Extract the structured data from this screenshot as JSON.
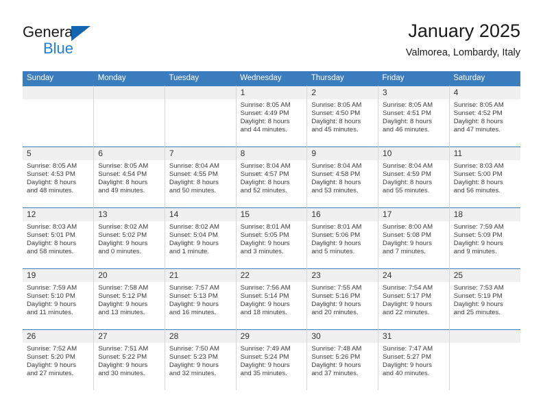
{
  "brand": {
    "name_dark": "General",
    "name_blue": "Blue",
    "accent_color": "#1f7fd4",
    "triangle_color": "#1265b0"
  },
  "header": {
    "title": "January 2025",
    "subtitle": "Valmorea, Lombardy, Italy"
  },
  "theme": {
    "header_row_bg": "#3a7cbe",
    "daynum_bg": "#f0f0f0",
    "cell_border": "#d4d4d4",
    "text": "#3a3a3a"
  },
  "weekday_headers": [
    "Sunday",
    "Monday",
    "Tuesday",
    "Wednesday",
    "Thursday",
    "Friday",
    "Saturday"
  ],
  "weeks": [
    [
      {
        "day": "",
        "lines": []
      },
      {
        "day": "",
        "lines": []
      },
      {
        "day": "",
        "lines": []
      },
      {
        "day": "1",
        "lines": [
          "Sunrise: 8:05 AM",
          "Sunset: 4:49 PM",
          "Daylight: 8 hours",
          "and 44 minutes."
        ]
      },
      {
        "day": "2",
        "lines": [
          "Sunrise: 8:05 AM",
          "Sunset: 4:50 PM",
          "Daylight: 8 hours",
          "and 45 minutes."
        ]
      },
      {
        "day": "3",
        "lines": [
          "Sunrise: 8:05 AM",
          "Sunset: 4:51 PM",
          "Daylight: 8 hours",
          "and 46 minutes."
        ]
      },
      {
        "day": "4",
        "lines": [
          "Sunrise: 8:05 AM",
          "Sunset: 4:52 PM",
          "Daylight: 8 hours",
          "and 47 minutes."
        ]
      }
    ],
    [
      {
        "day": "5",
        "lines": [
          "Sunrise: 8:05 AM",
          "Sunset: 4:53 PM",
          "Daylight: 8 hours",
          "and 48 minutes."
        ]
      },
      {
        "day": "6",
        "lines": [
          "Sunrise: 8:05 AM",
          "Sunset: 4:54 PM",
          "Daylight: 8 hours",
          "and 49 minutes."
        ]
      },
      {
        "day": "7",
        "lines": [
          "Sunrise: 8:04 AM",
          "Sunset: 4:55 PM",
          "Daylight: 8 hours",
          "and 50 minutes."
        ]
      },
      {
        "day": "8",
        "lines": [
          "Sunrise: 8:04 AM",
          "Sunset: 4:57 PM",
          "Daylight: 8 hours",
          "and 52 minutes."
        ]
      },
      {
        "day": "9",
        "lines": [
          "Sunrise: 8:04 AM",
          "Sunset: 4:58 PM",
          "Daylight: 8 hours",
          "and 53 minutes."
        ]
      },
      {
        "day": "10",
        "lines": [
          "Sunrise: 8:04 AM",
          "Sunset: 4:59 PM",
          "Daylight: 8 hours",
          "and 55 minutes."
        ]
      },
      {
        "day": "11",
        "lines": [
          "Sunrise: 8:03 AM",
          "Sunset: 5:00 PM",
          "Daylight: 8 hours",
          "and 56 minutes."
        ]
      }
    ],
    [
      {
        "day": "12",
        "lines": [
          "Sunrise: 8:03 AM",
          "Sunset: 5:01 PM",
          "Daylight: 8 hours",
          "and 58 minutes."
        ]
      },
      {
        "day": "13",
        "lines": [
          "Sunrise: 8:02 AM",
          "Sunset: 5:02 PM",
          "Daylight: 9 hours",
          "and 0 minutes."
        ]
      },
      {
        "day": "14",
        "lines": [
          "Sunrise: 8:02 AM",
          "Sunset: 5:04 PM",
          "Daylight: 9 hours",
          "and 1 minute."
        ]
      },
      {
        "day": "15",
        "lines": [
          "Sunrise: 8:01 AM",
          "Sunset: 5:05 PM",
          "Daylight: 9 hours",
          "and 3 minutes."
        ]
      },
      {
        "day": "16",
        "lines": [
          "Sunrise: 8:01 AM",
          "Sunset: 5:06 PM",
          "Daylight: 9 hours",
          "and 5 minutes."
        ]
      },
      {
        "day": "17",
        "lines": [
          "Sunrise: 8:00 AM",
          "Sunset: 5:08 PM",
          "Daylight: 9 hours",
          "and 7 minutes."
        ]
      },
      {
        "day": "18",
        "lines": [
          "Sunrise: 7:59 AM",
          "Sunset: 5:09 PM",
          "Daylight: 9 hours",
          "and 9 minutes."
        ]
      }
    ],
    [
      {
        "day": "19",
        "lines": [
          "Sunrise: 7:59 AM",
          "Sunset: 5:10 PM",
          "Daylight: 9 hours",
          "and 11 minutes."
        ]
      },
      {
        "day": "20",
        "lines": [
          "Sunrise: 7:58 AM",
          "Sunset: 5:12 PM",
          "Daylight: 9 hours",
          "and 13 minutes."
        ]
      },
      {
        "day": "21",
        "lines": [
          "Sunrise: 7:57 AM",
          "Sunset: 5:13 PM",
          "Daylight: 9 hours",
          "and 16 minutes."
        ]
      },
      {
        "day": "22",
        "lines": [
          "Sunrise: 7:56 AM",
          "Sunset: 5:14 PM",
          "Daylight: 9 hours",
          "and 18 minutes."
        ]
      },
      {
        "day": "23",
        "lines": [
          "Sunrise: 7:55 AM",
          "Sunset: 5:16 PM",
          "Daylight: 9 hours",
          "and 20 minutes."
        ]
      },
      {
        "day": "24",
        "lines": [
          "Sunrise: 7:54 AM",
          "Sunset: 5:17 PM",
          "Daylight: 9 hours",
          "and 22 minutes."
        ]
      },
      {
        "day": "25",
        "lines": [
          "Sunrise: 7:53 AM",
          "Sunset: 5:19 PM",
          "Daylight: 9 hours",
          "and 25 minutes."
        ]
      }
    ],
    [
      {
        "day": "26",
        "lines": [
          "Sunrise: 7:52 AM",
          "Sunset: 5:20 PM",
          "Daylight: 9 hours",
          "and 27 minutes."
        ]
      },
      {
        "day": "27",
        "lines": [
          "Sunrise: 7:51 AM",
          "Sunset: 5:22 PM",
          "Daylight: 9 hours",
          "and 30 minutes."
        ]
      },
      {
        "day": "28",
        "lines": [
          "Sunrise: 7:50 AM",
          "Sunset: 5:23 PM",
          "Daylight: 9 hours",
          "and 32 minutes."
        ]
      },
      {
        "day": "29",
        "lines": [
          "Sunrise: 7:49 AM",
          "Sunset: 5:24 PM",
          "Daylight: 9 hours",
          "and 35 minutes."
        ]
      },
      {
        "day": "30",
        "lines": [
          "Sunrise: 7:48 AM",
          "Sunset: 5:26 PM",
          "Daylight: 9 hours",
          "and 37 minutes."
        ]
      },
      {
        "day": "31",
        "lines": [
          "Sunrise: 7:47 AM",
          "Sunset: 5:27 PM",
          "Daylight: 9 hours",
          "and 40 minutes."
        ]
      },
      {
        "day": "",
        "lines": []
      }
    ]
  ]
}
